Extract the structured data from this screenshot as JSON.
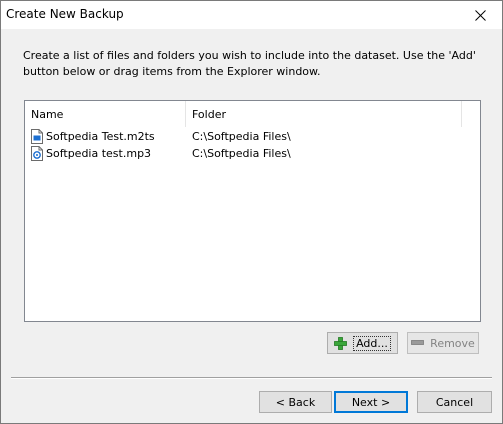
{
  "window": {
    "title": "Create New Backup"
  },
  "instructions": "Create a list of files and folders you wish to include into the dataset. Use the 'Add' button below or drag items from the Explorer window.",
  "list": {
    "columns": [
      "Name",
      "Folder"
    ],
    "rows": [
      {
        "name": "Softpedia Test.m2ts",
        "folder": "C:\\Softpedia Files\\",
        "icon": "video-file-icon"
      },
      {
        "name": "Softpedia test.mp3",
        "folder": "C:\\Softpedia Files\\",
        "icon": "audio-file-icon"
      }
    ]
  },
  "buttons": {
    "add": "Add...",
    "remove": "Remove",
    "back": "< Back",
    "next": "Next >",
    "cancel": "Cancel"
  },
  "colors": {
    "accent": "#0078d7",
    "add_icon": "#3aa63a"
  }
}
